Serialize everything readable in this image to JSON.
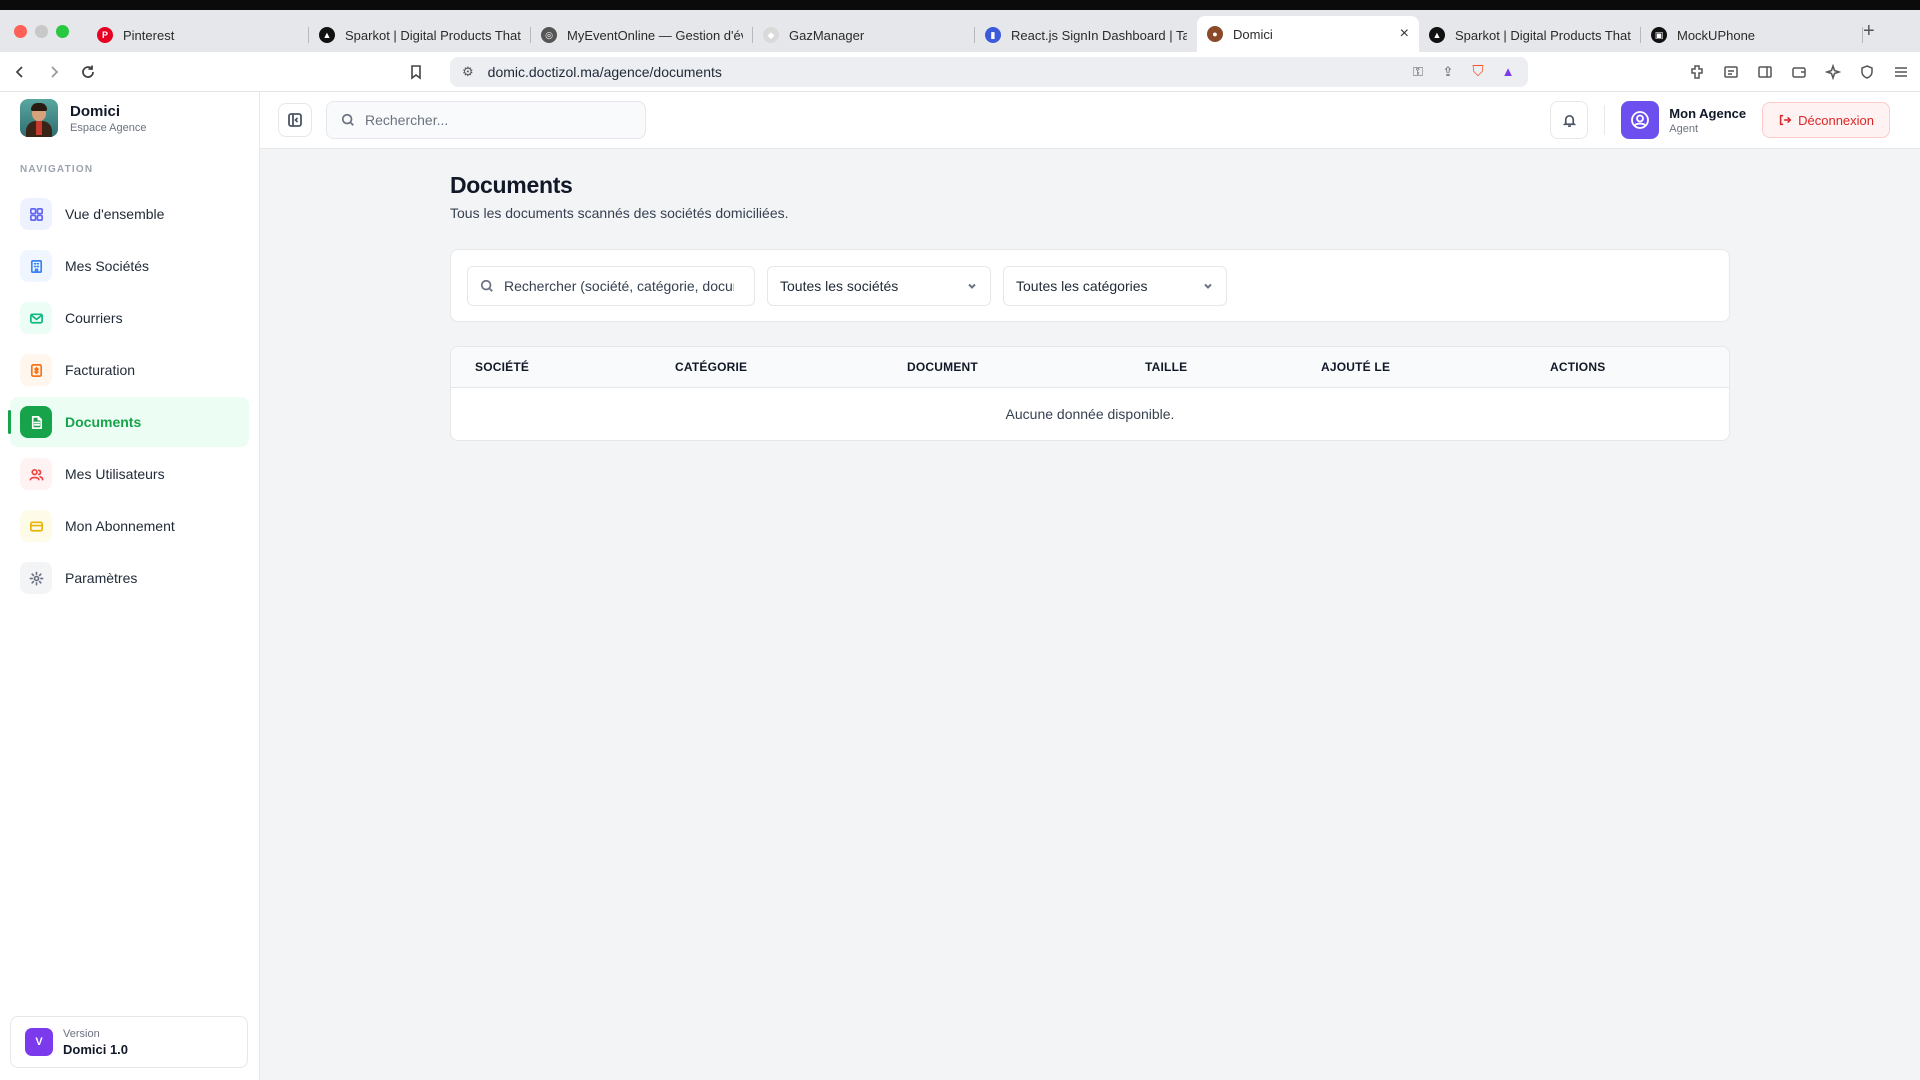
{
  "browser": {
    "tabs": [
      {
        "title": "Pinterest",
        "favicon_color": "#e60023",
        "favicon": "P"
      },
      {
        "title": "Sparkot | Digital Products That",
        "favicon_color": "#111111",
        "favicon": "▲"
      },
      {
        "title": "MyEventOnline — Gestion d'év",
        "favicon_color": "#555555",
        "favicon": "◎"
      },
      {
        "title": "GazManager",
        "favicon_color": "#d9d9d9",
        "favicon": "◆"
      },
      {
        "title": "React.js SignIn Dashboard | Ta",
        "favicon_color": "#3b5bdb",
        "favicon": "▮"
      },
      {
        "title": "Domici",
        "favicon_color": "#8a4a2a",
        "favicon": "●",
        "active": true
      },
      {
        "title": "Sparkot | Digital Products That",
        "favicon_color": "#111111",
        "favicon": "▲"
      },
      {
        "title": "MockUPhone",
        "favicon_color": "#111111",
        "favicon": "▣"
      }
    ],
    "url": "domic.doctizol.ma/agence/documents",
    "new_tab": "+",
    "close": "×"
  },
  "sidebar": {
    "brand_name": "Domici",
    "brand_sub": "Espace Agence",
    "nav_label": "NAVIGATION",
    "items": [
      {
        "label": "Vue d'ensemble",
        "icon": "grid-icon",
        "bg": "#eef2ff",
        "color": "#6366f1"
      },
      {
        "label": "Mes Sociétés",
        "icon": "building-icon",
        "bg": "#eff6ff",
        "color": "#3b82f6"
      },
      {
        "label": "Courriers",
        "icon": "mail-icon",
        "bg": "#ecfdf5",
        "color": "#10b981"
      },
      {
        "label": "Facturation",
        "icon": "invoice-icon",
        "bg": "#fff7ed",
        "color": "#f97316"
      },
      {
        "label": "Documents",
        "icon": "document-icon",
        "bg": "#16a34a",
        "color": "#ffffff",
        "active": true
      },
      {
        "label": "Mes Utilisateurs",
        "icon": "users-icon",
        "bg": "#fef2f2",
        "color": "#ef4444"
      },
      {
        "label": "Mon Abonnement",
        "icon": "card-icon",
        "bg": "#fefce8",
        "color": "#eab308"
      },
      {
        "label": "Paramètres",
        "icon": "gear-icon",
        "bg": "#f3f4f6",
        "color": "#6b7280"
      }
    ],
    "version_label": "Version",
    "version_value": "Domici 1.0",
    "version_badge": "V"
  },
  "topbar": {
    "search_placeholder": "Rechercher...",
    "agency_name": "Mon Agence",
    "agency_role": "Agent",
    "logout_label": "Déconnexion"
  },
  "page": {
    "title": "Documents",
    "subtitle": "Tous les documents scannés des sociétés domiciliées.",
    "filter_search_placeholder": "Rechercher (société, catégorie, document)...",
    "filter_company": "Toutes les sociétés",
    "filter_category": "Toutes les catégories",
    "table": {
      "columns": [
        "SOCIÉTÉ",
        "CATÉGORIE",
        "DOCUMENT",
        "TAILLE",
        "AJOUTÉ LE",
        "ACTIONS"
      ],
      "empty": "Aucune donnée disponible."
    }
  }
}
